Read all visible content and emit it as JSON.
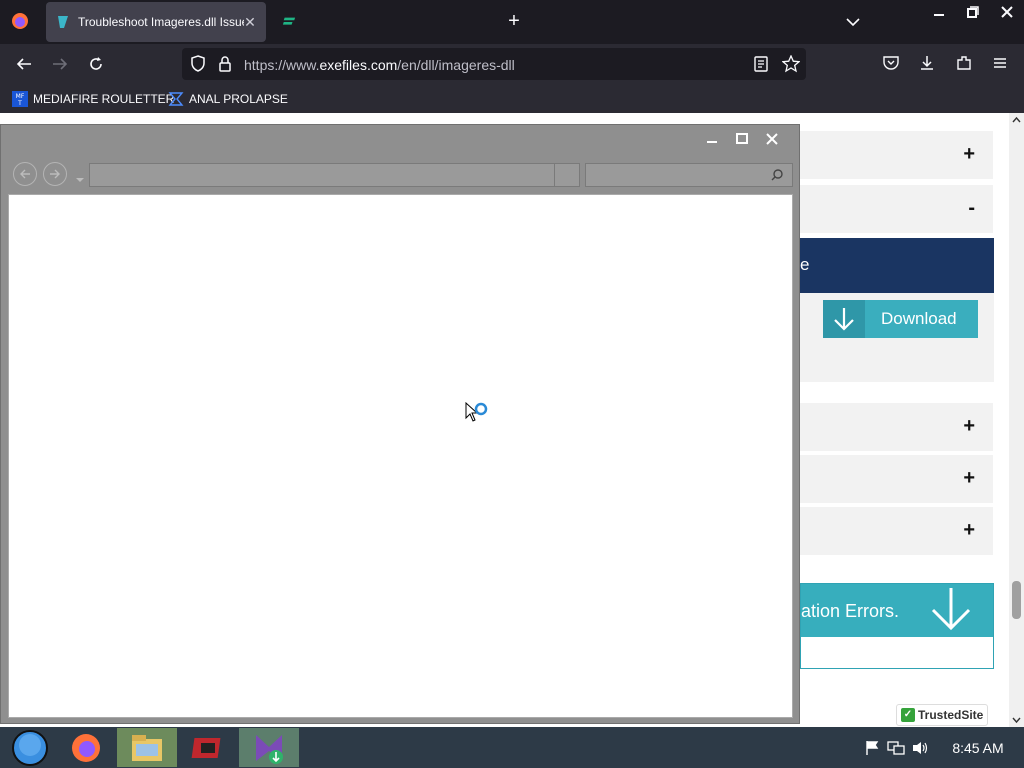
{
  "browser": {
    "tabs": [
      {
        "title": "Troubleshoot Imageres.dll Issue",
        "active": true
      },
      {
        "title": "",
        "active": false
      }
    ],
    "new_tab_symbol": "+",
    "tab_close_symbol": "✕",
    "url_prefix": "https://www.",
    "url_domain": "exefiles.com",
    "url_path": "/en/dll/imageres-dll",
    "bookmarks": [
      {
        "label": "MEDIAFIRE ROULETTER",
        "icon": "mediafire-icon"
      },
      {
        "label": "ANAL PROLAPSE",
        "icon": "bookmark-favicon-icon"
      }
    ]
  },
  "page": {
    "accordions": [
      {
        "sign": "+"
      },
      {
        "sign": "-"
      },
      {
        "sign": "+"
      },
      {
        "sign": "+"
      },
      {
        "sign": "+"
      }
    ],
    "dark_bar_text": "e",
    "download_label": "Download",
    "error_banner_text": "ation Errors.",
    "trusted_site_label": "TrustedSite"
  },
  "taskbar": {
    "clock": "8:45 AM"
  },
  "colors": {
    "tabstrip": "#1c1b22",
    "toolbar": "#2b2a33",
    "dark_bar": "#1a3562",
    "teal": "#3aaebe",
    "taskbar": "#2d3a47"
  }
}
